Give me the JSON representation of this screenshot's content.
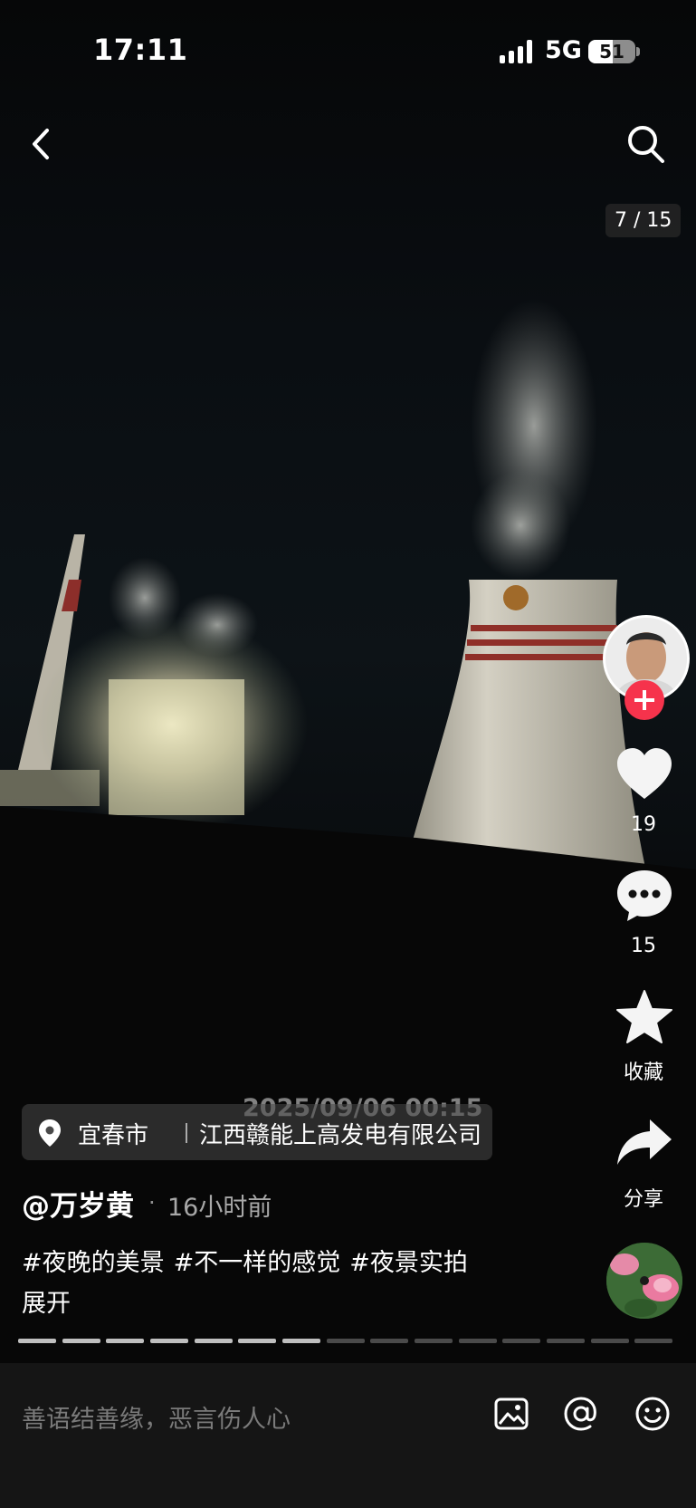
{
  "status_bar": {
    "time": "17:11",
    "network": "5G",
    "battery_level": "51"
  },
  "counter": "7 / 15",
  "photo": {
    "watermark": "2025/09/06 00:15"
  },
  "location": {
    "city": "宜春市",
    "place": "江西赣能上高发电有限公司"
  },
  "post": {
    "author": "@万岁黄",
    "separator": "·",
    "time_ago": "16小时前",
    "hashtags": [
      "#夜晚的美景",
      "#不一样的感觉",
      "#夜景实拍"
    ],
    "expand_label": "展开"
  },
  "actions": {
    "likes": "19",
    "comments": "15",
    "favorite_label": "收藏",
    "share_label": "分享"
  },
  "progress": {
    "total": 15,
    "current": 7
  },
  "comment_bar": {
    "placeholder": "善语结善缘，恶言伤人心"
  },
  "icons": [
    "back-icon",
    "search-icon",
    "location-pin-icon",
    "heart-icon",
    "comment-icon",
    "star-icon",
    "share-icon",
    "image-icon",
    "at-icon",
    "emoji-icon"
  ],
  "colors": {
    "follow_badge": "#f6334c",
    "bar_bg": "#151515",
    "progress_active": "#bfbfbf",
    "progress_inactive": "#4a4a4a"
  }
}
